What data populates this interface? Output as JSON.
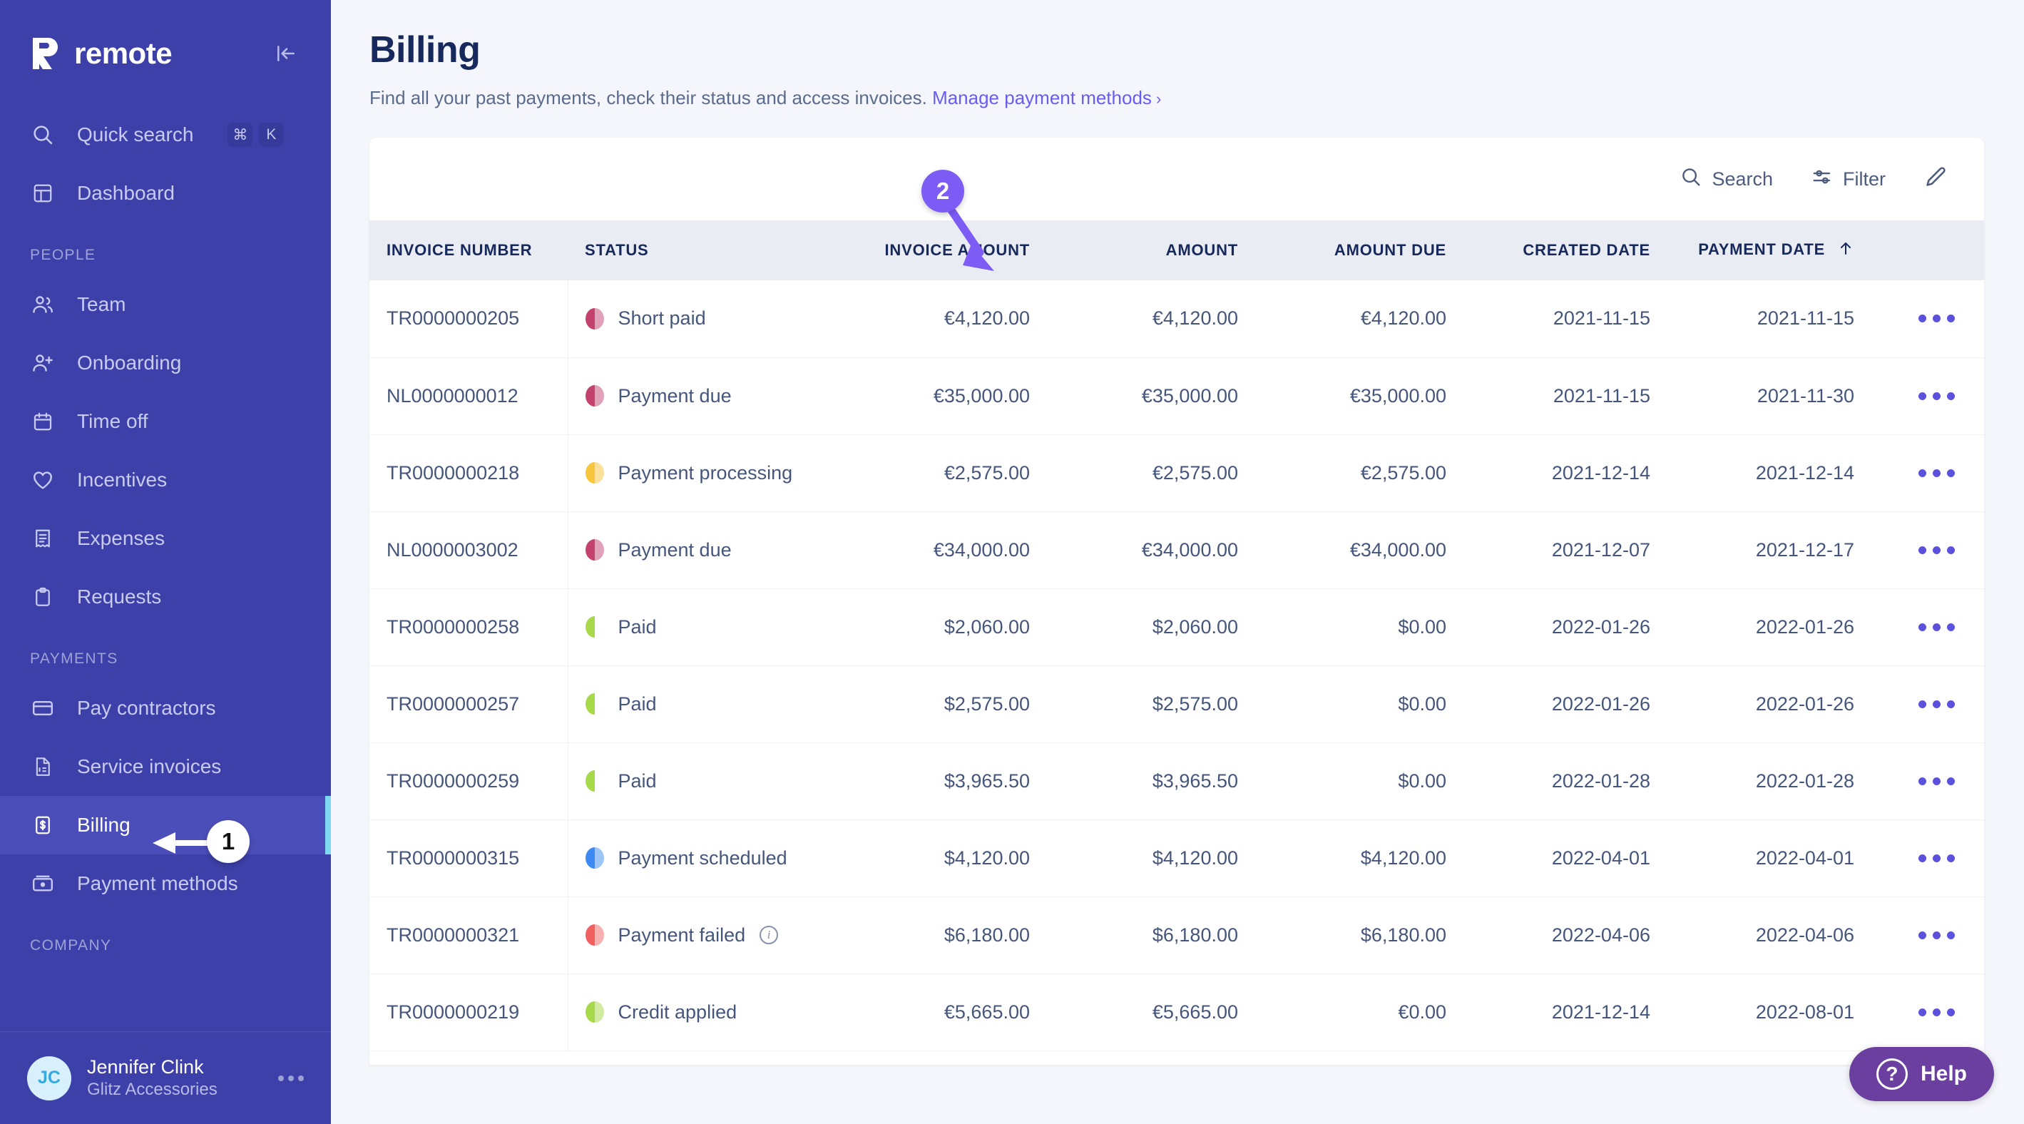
{
  "brand": {
    "name": "remote",
    "logo_icon": "remote-r-logo",
    "collapse_icon": "collapse-sidebar-icon"
  },
  "sidebar": {
    "quick_search": {
      "label": "Quick search",
      "icon": "search-icon",
      "keys": [
        "⌘",
        "K"
      ]
    },
    "dashboard": {
      "label": "Dashboard",
      "icon": "dashboard-icon"
    },
    "sections": [
      {
        "label": "PEOPLE",
        "items": [
          {
            "label": "Team",
            "icon": "users-icon"
          },
          {
            "label": "Onboarding",
            "icon": "user-plus-icon"
          },
          {
            "label": "Time off",
            "icon": "calendar-icon"
          },
          {
            "label": "Incentives",
            "icon": "heart-icon"
          },
          {
            "label": "Expenses",
            "icon": "receipt-icon"
          },
          {
            "label": "Requests",
            "icon": "clipboard-icon"
          }
        ]
      },
      {
        "label": "PAYMENTS",
        "items": [
          {
            "label": "Pay contractors",
            "icon": "credit-card-icon"
          },
          {
            "label": "Service invoices",
            "icon": "invoice-doc-icon"
          },
          {
            "label": "Billing",
            "icon": "billing-dollar-icon",
            "active": true
          },
          {
            "label": "Payment methods",
            "icon": "money-note-icon"
          }
        ]
      },
      {
        "label": "COMPANY",
        "items": []
      }
    ],
    "user": {
      "initials": "JC",
      "name": "Jennifer Clink",
      "org": "Glitz Accessories",
      "menu_icon": "more-horizontal-icon"
    }
  },
  "header": {
    "title": "Billing",
    "description": "Find all your past payments, check their status and access invoices.",
    "link_label": "Manage payment methods",
    "link_chevron": "chevron-right-icon"
  },
  "toolbar": {
    "search_label": "Search",
    "search_icon": "search-icon",
    "filter_label": "Filter",
    "filter_icon": "sliders-icon",
    "edit_icon": "pencil-icon"
  },
  "table": {
    "columns": [
      {
        "key": "invoice_number",
        "label": "INVOICE NUMBER",
        "align": "left"
      },
      {
        "key": "status",
        "label": "STATUS",
        "align": "left"
      },
      {
        "key": "invoice_amount",
        "label": "INVOICE AMOUNT",
        "align": "right"
      },
      {
        "key": "amount",
        "label": "AMOUNT",
        "align": "right"
      },
      {
        "key": "amount_due",
        "label": "AMOUNT DUE",
        "align": "right"
      },
      {
        "key": "created_date",
        "label": "CREATED DATE",
        "align": "right"
      },
      {
        "key": "payment_date",
        "label": "PAYMENT DATE",
        "align": "right",
        "sort": "asc",
        "sort_icon": "arrow-up-icon"
      },
      {
        "key": "actions",
        "label": "",
        "align": "center"
      }
    ],
    "row_action_icon": "more-horizontal-icon",
    "status_colors": {
      "short-paid": {
        "dark": "#c3436e",
        "light": "#dfa2b8"
      },
      "payment-due": {
        "dark": "#c3436e",
        "light": "#dfa2b8"
      },
      "payment-processing": {
        "dark": "#f8c63c",
        "light": "#fbe09b"
      },
      "paid": {
        "dark": "#a8d94a",
        "light": "#d2ebа0"
      },
      "payment-scheduled": {
        "dark": "#3d8bf2",
        "light": "#9ec5f8"
      },
      "payment-failed": {
        "dark": "#f0605f",
        "light": "#f7b0b0"
      },
      "credit-applied": {
        "dark": "#a8d94a",
        "light": "#d2eba0"
      }
    },
    "rows": [
      {
        "invoice_number": "TR0000000205",
        "status": "Short paid",
        "status_key": "short-paid",
        "info": false,
        "invoice_amount": "€4,120.00",
        "amount": "€4,120.00",
        "amount_due": "€4,120.00",
        "created_date": "2021-11-15",
        "payment_date": "2021-11-15"
      },
      {
        "invoice_number": "NL0000000012",
        "status": "Payment due",
        "status_key": "payment-due",
        "info": false,
        "invoice_amount": "€35,000.00",
        "amount": "€35,000.00",
        "amount_due": "€35,000.00",
        "created_date": "2021-11-15",
        "payment_date": "2021-11-30"
      },
      {
        "invoice_number": "TR0000000218",
        "status": "Payment processing",
        "status_key": "payment-processing",
        "info": false,
        "invoice_amount": "€2,575.00",
        "amount": "€2,575.00",
        "amount_due": "€2,575.00",
        "created_date": "2021-12-14",
        "payment_date": "2021-12-14"
      },
      {
        "invoice_number": "NL0000003002",
        "status": "Payment due",
        "status_key": "payment-due",
        "info": false,
        "invoice_amount": "€34,000.00",
        "amount": "€34,000.00",
        "amount_due": "€34,000.00",
        "created_date": "2021-12-07",
        "payment_date": "2021-12-17"
      },
      {
        "invoice_number": "TR0000000258",
        "status": "Paid",
        "status_key": "paid",
        "info": false,
        "invoice_amount": "$2,060.00",
        "amount": "$2,060.00",
        "amount_due": "$0.00",
        "created_date": "2022-01-26",
        "payment_date": "2022-01-26"
      },
      {
        "invoice_number": "TR0000000257",
        "status": "Paid",
        "status_key": "paid",
        "info": false,
        "invoice_amount": "$2,575.00",
        "amount": "$2,575.00",
        "amount_due": "$0.00",
        "created_date": "2022-01-26",
        "payment_date": "2022-01-26"
      },
      {
        "invoice_number": "TR0000000259",
        "status": "Paid",
        "status_key": "paid",
        "info": false,
        "invoice_amount": "$3,965.50",
        "amount": "$3,965.50",
        "amount_due": "$0.00",
        "created_date": "2022-01-28",
        "payment_date": "2022-01-28"
      },
      {
        "invoice_number": "TR0000000315",
        "status": "Payment scheduled",
        "status_key": "payment-scheduled",
        "info": false,
        "invoice_amount": "$4,120.00",
        "amount": "$4,120.00",
        "amount_due": "$4,120.00",
        "created_date": "2022-04-01",
        "payment_date": "2022-04-01"
      },
      {
        "invoice_number": "TR0000000321",
        "status": "Payment failed",
        "status_key": "payment-failed",
        "info": true,
        "invoice_amount": "$6,180.00",
        "amount": "$6,180.00",
        "amount_due": "$6,180.00",
        "created_date": "2022-04-06",
        "payment_date": "2022-04-06"
      },
      {
        "invoice_number": "TR0000000219",
        "status": "Credit applied",
        "status_key": "credit-applied",
        "info": false,
        "invoice_amount": "€5,665.00",
        "amount": "€5,665.00",
        "amount_due": "€0.00",
        "created_date": "2021-12-14",
        "payment_date": "2022-08-01"
      }
    ]
  },
  "annotations": [
    {
      "id": 1,
      "number": "1",
      "target": "Billing",
      "style": "white-circle-black-text-left-arrow"
    },
    {
      "id": 2,
      "number": "2",
      "target": "STATUS",
      "style": "purple-circle-white-text-down-arrow"
    }
  ],
  "help": {
    "label": "Help",
    "icon": "question-circle-icon",
    "color": "#6b3fa0"
  }
}
